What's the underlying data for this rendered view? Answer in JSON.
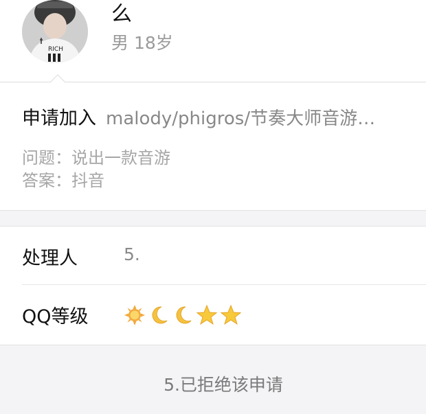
{
  "profile": {
    "name": "么",
    "gender": "男",
    "age": "18岁",
    "avatar_text": "RICH"
  },
  "application": {
    "label": "申请加入",
    "group": "malody/phigros/节奏大师音游…",
    "question_label": "问题：",
    "question": "说出一款音游",
    "answer_label": "答案：",
    "answer": "抖音"
  },
  "handler": {
    "label": "处理人",
    "value": "5."
  },
  "qq_level": {
    "label": "QQ等级",
    "icons": [
      "sun-icon",
      "moon-icon",
      "moon-icon",
      "star-icon",
      "star-icon"
    ]
  },
  "status": {
    "text": "5.已拒绝该申请"
  }
}
